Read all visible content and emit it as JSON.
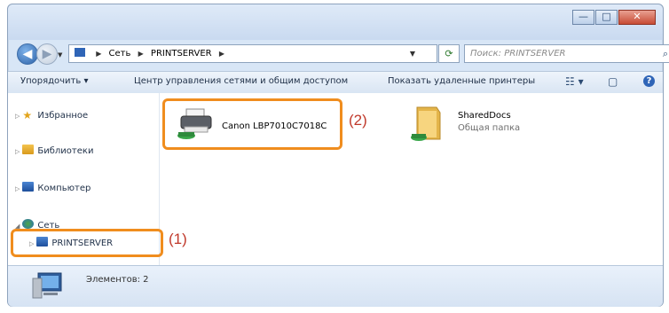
{
  "window": {
    "controls": {
      "minimize": "—",
      "maximize": "□",
      "close": "✕"
    }
  },
  "navigation": {
    "back_icon": "back-arrow-icon",
    "forward_icon": "forward-arrow-icon",
    "address_parts": [
      "Сеть",
      "PRINTSERVER"
    ],
    "search_placeholder": "Поиск: PRINTSERVER"
  },
  "toolbar": {
    "organize_label": "Упорядочить ▾",
    "network_center_label": "Центр управления сетями и общим доступом",
    "show_remote_printers_label": "Показать удаленные принтеры",
    "view_icon": "view-options-icon",
    "help_label": "?"
  },
  "sidebar": {
    "items": [
      {
        "label": "Избранное",
        "icon": "star-icon"
      },
      {
        "label": "Библиотеки",
        "icon": "library-icon"
      },
      {
        "label": "Компьютер",
        "icon": "computer-icon"
      },
      {
        "label": "Сеть",
        "icon": "network-icon"
      },
      {
        "label": "PRINTSERVER",
        "icon": "computer-icon"
      }
    ]
  },
  "content": {
    "items": [
      {
        "name": "Canon LBP7010C7018C",
        "subtitle": "",
        "icon": "shared-printer-icon"
      },
      {
        "name": "SharedDocs",
        "subtitle": "Общая папка",
        "icon": "shared-folder-icon"
      }
    ]
  },
  "status_bar": {
    "text": "Элементов: 2"
  },
  "annotations": {
    "callout_1": "(1)",
    "callout_2": "(2)",
    "highlight_color": "#f08d1e",
    "callout_color": "#c0392b"
  }
}
